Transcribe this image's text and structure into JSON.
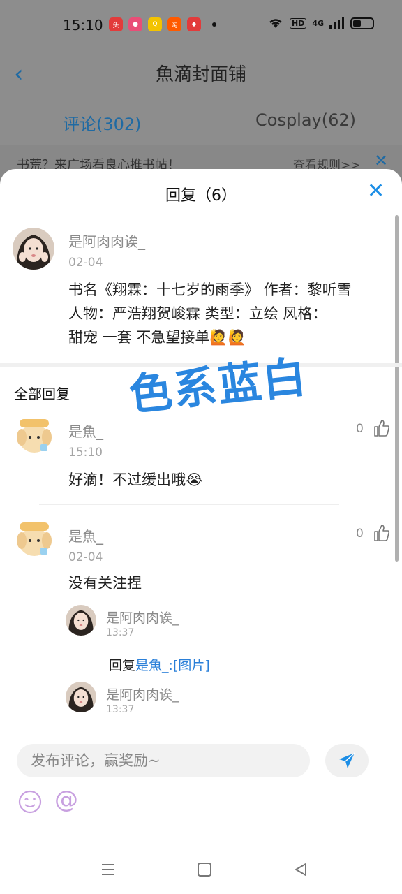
{
  "status_bar": {
    "time": "15:10",
    "hd": "HD",
    "signal": "4G"
  },
  "page": {
    "title": "魚滴封面铺",
    "tabs": [
      {
        "label": "评论(302)"
      },
      {
        "label": "Cosplay(62)"
      }
    ],
    "notice": {
      "text": "书荒？来广场看良心推书帖！",
      "link": "查看规则>>"
    }
  },
  "sheet": {
    "title": "回复（6）",
    "main_comment": {
      "user": "是阿肉肉诶_",
      "date": "02-04",
      "lines": [
        "书名《翔霖：十七岁的雨季》 作者：黎听雪",
        "人物：严浩翔贺峻霖  类型：立绘  风格：",
        "甜宠  一套   不急望接单🙋🙋"
      ]
    },
    "watermark": "色系蓝白",
    "section_title": "全部回复",
    "replies": [
      {
        "user": "是魚_",
        "time": "15:10",
        "text": "好滴！不过缓出哦😭",
        "likes": "0"
      },
      {
        "user": "是魚_",
        "date": "02-04",
        "text": "没有关注捏",
        "likes": "0"
      }
    ],
    "sub_replies": [
      {
        "user": "是阿肉肉诶_",
        "time": "13:37"
      },
      {
        "user": "是阿肉肉诶_",
        "time": "13:37"
      }
    ],
    "reply_line": {
      "prefix": "回复",
      "target": "是魚_:",
      "content": "[图片]"
    }
  },
  "composer": {
    "placeholder": "发布评论，赢奖励~"
  },
  "colors": {
    "accent": "#1c8ee6",
    "link": "#2a7fd8",
    "dim_overlay": "#8d8d8d"
  },
  "icons": [
    "back-icon",
    "close-icon",
    "thumb-up-icon",
    "send-icon",
    "emoji-icon",
    "at-icon",
    "menu-icon",
    "home-icon",
    "back-nav-icon"
  ]
}
